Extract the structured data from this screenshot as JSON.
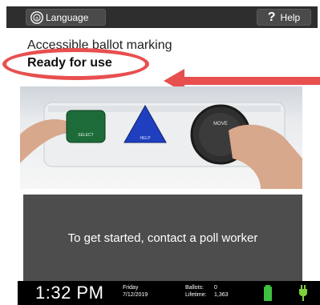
{
  "header": {
    "language_label": "Language",
    "help_label": "Help"
  },
  "content": {
    "app_title": "Accessible ballot marking",
    "status": "Ready for use"
  },
  "photo": {
    "buttons": {
      "select_label": "SELECT",
      "help_label": "HELP",
      "move_label": "MOVE"
    }
  },
  "message": {
    "text": "To get started, contact a poll worker"
  },
  "statusbar": {
    "time": "1:32 PM",
    "day": "Friday",
    "date": "7/12/2019",
    "ballots_label": "Ballots:",
    "ballots_value": "0",
    "lifetime_label": "Lifetime:",
    "lifetime_value": "1,363"
  },
  "colors": {
    "callout": "#e84f4f",
    "battery": "#3ec13e",
    "plug": "#7dd23a",
    "select_button": "#1e6b3a",
    "help_button": "#1f3fbf"
  },
  "icons": {
    "language": "accessibility-language-icon",
    "help": "question-mark-icon",
    "battery": "battery-full-icon",
    "power": "power-plug-icon"
  }
}
